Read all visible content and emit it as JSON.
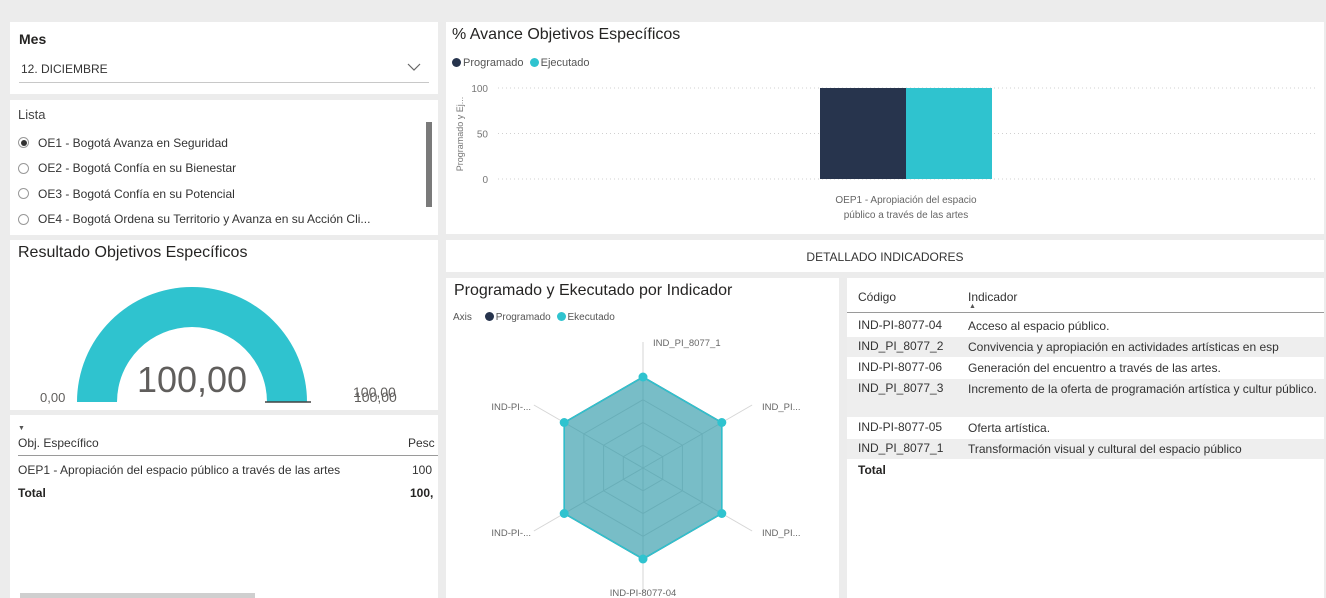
{
  "mes_slicer": {
    "title": "Mes",
    "selected": "12. DICIEMBRE"
  },
  "lista": {
    "title": "Lista",
    "items": [
      {
        "label": "OE1 - Bogotá Avanza en Seguridad",
        "selected": true
      },
      {
        "label": "OE2 - Bogotá Confía en su Bienestar",
        "selected": false
      },
      {
        "label": "OE3 - Bogotá Confía en su Potencial",
        "selected": false
      },
      {
        "label": "OE4 - Bogotá Ordena su Territorio y Avanza en su Acción Cli...",
        "selected": false
      }
    ]
  },
  "gauge": {
    "title": "Resultado Objetivos Específicos",
    "value": 100,
    "value_label": "100,00",
    "min_label": "0,00",
    "max_label": "100,00",
    "target_label": "100,00",
    "fill_color": "#2fc3cf",
    "track_color": "#ededed"
  },
  "obj_table": {
    "headers": [
      "Obj. Específico",
      "Pesc"
    ],
    "rows": [
      [
        "OEP1 - Apropiación del espacio público a través de las artes",
        "100"
      ]
    ],
    "total": [
      "Total",
      "100,"
    ]
  },
  "avance_chart": {
    "title": "% Avance Objetivos Específicos",
    "chart_data": {
      "type": "bar",
      "title": "% Avance Objetivos Específicos",
      "categories": [
        "OEP1 - Apropiación del espacio público a través de las artes"
      ],
      "category_label_lines": [
        "OEP1 - Apropiación del espacio",
        "público a través de las artes"
      ],
      "series": [
        {
          "name": "Programado",
          "values": [
            100
          ],
          "color": "#27344d"
        },
        {
          "name": "Ejecutado",
          "values": [
            100
          ],
          "color": "#2fc3cf"
        }
      ],
      "ylabel": "Programado y Ej...",
      "ylim": [
        0,
        100
      ],
      "yticks": [
        "100",
        "50",
        "0"
      ],
      "grid": true,
      "legend": "top-left"
    }
  },
  "detallado": {
    "title": "DETALLADO INDICADORES"
  },
  "radar_chart": {
    "title": "Programado y Ekecutado por Indicador",
    "legend_axis": "Axis",
    "chart_data": {
      "type": "radar",
      "title": "Programado y Ekecutado por Indicador",
      "axes": [
        "IND_PI_8077_1",
        "IND_PI...",
        "IND_PI...",
        "IND-PI-8077-04",
        "IND-PI-...",
        "IND-PI-..."
      ],
      "series": [
        {
          "name": "Programado",
          "values": [
            100,
            100,
            100,
            100,
            100,
            100
          ],
          "color": "#27344d"
        },
        {
          "name": "Ekecutado",
          "values": [
            100,
            100,
            100,
            100,
            100,
            100
          ],
          "color": "#2fc3cf"
        }
      ],
      "max": 100,
      "legend": "top-left"
    }
  },
  "indicator_table": {
    "headers": [
      "Código",
      "Indicador"
    ],
    "rows": [
      [
        "IND-PI-8077-04",
        "Acceso al espacio público."
      ],
      [
        "IND_PI_8077_2",
        "Convivencia y apropiación en actividades artísticas en esp"
      ],
      [
        "IND-PI-8077-06",
        "Generación del encuentro a través de las artes."
      ],
      [
        "IND_PI_8077_3",
        "Incremento de la oferta de programación artística y cultur público."
      ],
      [
        "IND-PI-8077-05",
        "Oferta artística."
      ],
      [
        "IND_PI_8077_1",
        "Transformación visual y cultural del espacio público"
      ]
    ],
    "total": "Total"
  }
}
